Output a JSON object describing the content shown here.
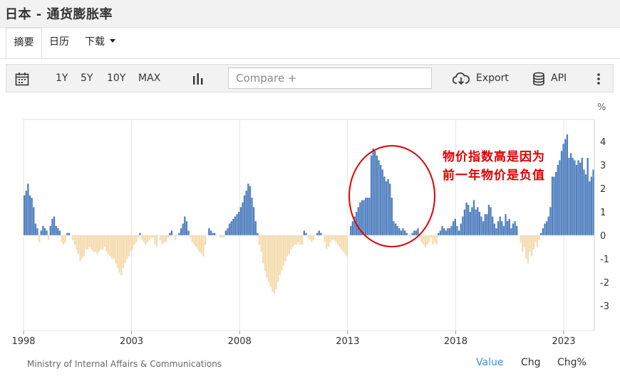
{
  "header": {
    "title": "日本 - 通货膨胀率"
  },
  "tabs": [
    {
      "label": "摘要",
      "active": true
    },
    {
      "label": "日历",
      "active": false
    },
    {
      "label": "下载",
      "active": false
    }
  ],
  "toolbar": {
    "ranges": [
      "1Y",
      "5Y",
      "10Y",
      "MAX"
    ],
    "compare_placeholder": "Compare +",
    "export_label": "Export",
    "api_label": "API",
    "icons": [
      "calendar-icon",
      "bar-chart-icon",
      "cloud-download-icon",
      "database-icon",
      "more-vertical-icon"
    ]
  },
  "annotation": {
    "line1": "物价指数高是因为",
    "line2": "前一年物价是负值"
  },
  "source": "Ministry of Internal Affairs & Communications",
  "view_options": [
    {
      "label": "Value",
      "active": true
    },
    {
      "label": "Chg",
      "active": false
    },
    {
      "label": "Chg%",
      "active": false
    }
  ],
  "colors": {
    "positive": "#4f7fbf",
    "negative": "#f5dcb0",
    "annotation": "#e00000",
    "accent": "#3d8fd6"
  },
  "chart_data": {
    "type": "bar",
    "unit": "%",
    "ylim": [
      -4,
      5
    ],
    "yticks": [
      4,
      3,
      2,
      1,
      0,
      -1,
      -2,
      -3
    ],
    "xticks": [
      "1998",
      "2003",
      "2008",
      "2013",
      "2018",
      "2023"
    ],
    "x_start": "1998-01",
    "x_end": "2024-06",
    "legend": "none",
    "grid": "vertical",
    "series": [
      {
        "values": [
          1.7,
          1.9,
          2.2,
          1.7,
          1.6,
          1.2,
          0.5,
          0.3,
          -0.3,
          0.2,
          0.4,
          0.3,
          0.2,
          -0.2,
          0.4,
          0.7,
          0.8,
          0.4,
          0.3,
          0.2,
          -0.3,
          -0.4,
          -0.3,
          0.1,
          0.1,
          0.0,
          -0.2,
          -0.4,
          -0.6,
          -0.8,
          -1.1,
          -1.0,
          -0.9,
          -0.6,
          -0.6,
          -0.5,
          -0.6,
          -0.7,
          -0.7,
          -0.8,
          -0.7,
          -0.6,
          -0.6,
          -0.5,
          -0.7,
          -0.8,
          -0.9,
          -1.0,
          -1.0,
          -1.2,
          -1.4,
          -1.6,
          -1.7,
          -1.4,
          -1.2,
          -1.0,
          -0.9,
          -0.7,
          -0.6,
          -0.4,
          -0.3,
          -0.1,
          0.1,
          -0.2,
          -0.3,
          -0.4,
          -0.3,
          -0.2,
          -0.1,
          -0.1,
          -0.4,
          -0.5,
          0.0,
          -0.2,
          -0.4,
          -0.3,
          -0.3,
          -0.1,
          0.1,
          0.2,
          0.0,
          -0.2,
          0.0,
          0.1,
          0.3,
          0.5,
          0.8,
          0.6,
          0.2,
          -0.1,
          -0.3,
          -0.4,
          -0.5,
          -0.6,
          -0.7,
          -0.8,
          -0.9,
          -0.4,
          0.0,
          0.3,
          0.2,
          0.1,
          0.1,
          0.0,
          0.0,
          -0.1,
          -0.1,
          -0.1,
          0.2,
          0.3,
          0.5,
          0.6,
          0.7,
          0.8,
          0.9,
          1.0,
          1.2,
          1.4,
          1.7,
          1.9,
          2.2,
          2.1,
          1.6,
          1.2,
          0.6,
          0.1,
          -0.4,
          -0.7,
          -1.2,
          -1.5,
          -1.8,
          -2.0,
          -2.2,
          -2.4,
          -2.5,
          -2.3,
          -2.0,
          -1.7,
          -1.5,
          -1.3,
          -1.1,
          -0.9,
          -0.8,
          -0.6,
          -0.5,
          -0.4,
          -0.4,
          -0.3,
          -0.4,
          -0.4,
          0.2,
          0.1,
          -0.1,
          -0.2,
          -0.3,
          -0.2,
          0.0,
          0.1,
          0.2,
          0.1,
          0.0,
          -0.3,
          -0.6,
          -0.5,
          -0.3,
          -0.2,
          -0.2,
          -0.3,
          -0.4,
          -0.5,
          -0.6,
          -0.7,
          -0.8,
          -0.9,
          0.0,
          0.4,
          0.6,
          0.8,
          1.0,
          1.2,
          1.4,
          1.5,
          1.5,
          1.6,
          1.6,
          1.6,
          3.4,
          3.7,
          3.6,
          3.4,
          3.2,
          3.0,
          2.8,
          2.5,
          2.3,
          2.4,
          2.2,
          1.6,
          0.6,
          0.5,
          0.4,
          0.3,
          0.2,
          0.3,
          0.2,
          0.1,
          0.0,
          -0.1,
          0.1,
          0.2,
          0.2,
          0.3,
          -0.1,
          -0.3,
          -0.4,
          -0.5,
          -0.4,
          -0.3,
          -0.1,
          -0.4,
          -0.3,
          -0.4,
          0.1,
          0.2,
          0.4,
          0.3,
          0.2,
          0.3,
          0.3,
          0.4,
          0.6,
          0.7,
          0.4,
          0.2,
          0.5,
          0.8,
          1.1,
          1.4,
          1.3,
          1.0,
          1.2,
          1.5,
          1.1,
          1.2,
          1.0,
          0.8,
          0.6,
          0.9,
          0.9,
          1.3,
          1.2,
          0.8,
          0.5,
          0.3,
          0.6,
          0.8,
          0.6,
          0.4,
          0.9,
          0.6,
          0.7,
          0.3,
          0.5,
          0.6,
          0.4,
          0.0,
          -0.3,
          -0.7,
          -0.5,
          -1.0,
          -1.2,
          -0.7,
          -0.9,
          -0.6,
          -0.3,
          -0.5,
          -0.2,
          0.1,
          0.3,
          0.5,
          0.6,
          0.8,
          1.2,
          2.5,
          2.5,
          2.7,
          3.0,
          3.2,
          3.6,
          3.9,
          4.1,
          4.3,
          3.3,
          3.5,
          3.3,
          3.2,
          3.0,
          3.2,
          3.1,
          3.3,
          2.8,
          2.6,
          3.3,
          2.3,
          2.5,
          2.8
        ]
      }
    ]
  }
}
